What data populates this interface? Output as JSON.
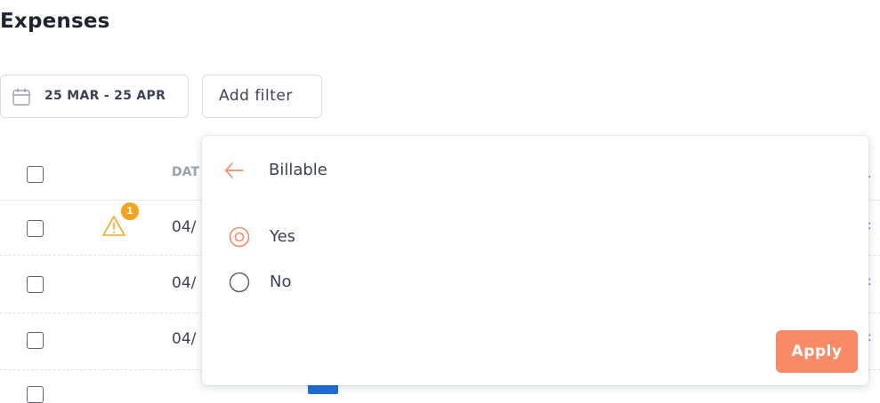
{
  "page": {
    "title": "Expenses"
  },
  "toolbar": {
    "date_range_label": "25 MAR - 25 APR",
    "add_filter_label": "Add filter"
  },
  "table": {
    "date_header_fragment": "DAT",
    "rows": [
      {
        "date_fragment": "04/",
        "warning_count": "1"
      },
      {
        "date_fragment": "04/"
      },
      {
        "date_fragment": "04/"
      }
    ]
  },
  "filter_popover": {
    "title": "Billable",
    "options": [
      {
        "label": "Yes",
        "selected": true
      },
      {
        "label": "No",
        "selected": false
      }
    ],
    "apply_label": "Apply",
    "accent_color": "#fa8a67"
  }
}
